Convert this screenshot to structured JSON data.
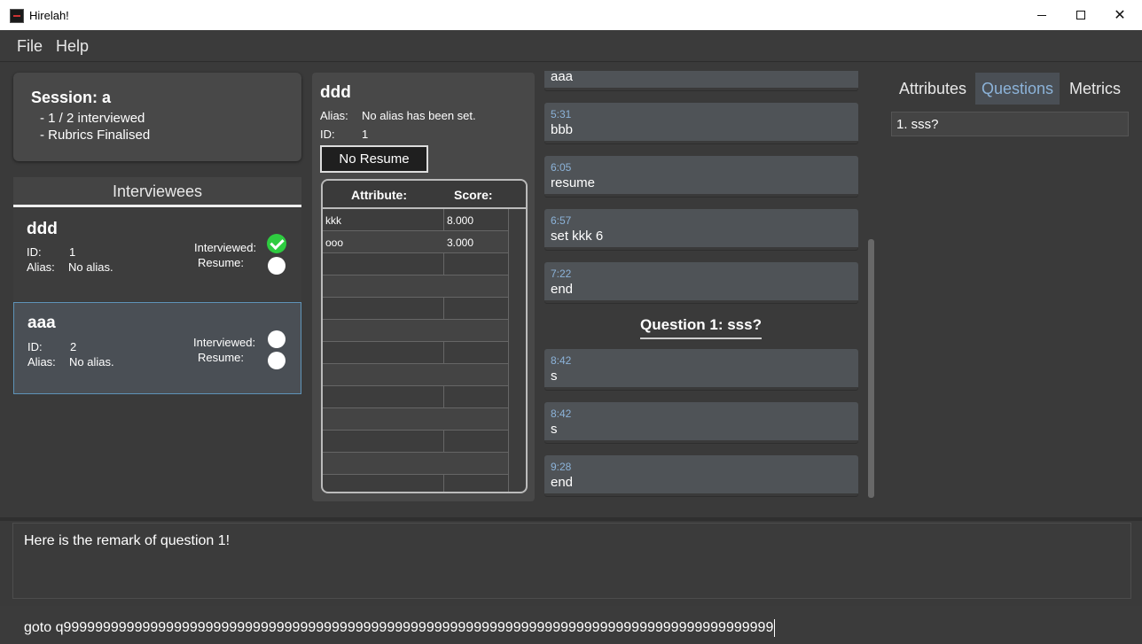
{
  "window": {
    "title": "Hirelah!"
  },
  "menu": {
    "file": "File",
    "help": "Help"
  },
  "session": {
    "title": "Session: a",
    "line1": "- 1 / 2 interviewed",
    "line2": "- Rubrics Finalised"
  },
  "interviewees": {
    "header": "Interviewees",
    "items": [
      {
        "name": "ddd",
        "id_label": "ID:",
        "id": "1",
        "alias_label": "Alias:",
        "alias": "No alias.",
        "interviewed_label": "Interviewed:",
        "resume_label": "Resume:"
      },
      {
        "name": "aaa",
        "id_label": "ID:",
        "id": "2",
        "alias_label": "Alias:",
        "alias": "No alias.",
        "interviewed_label": "Interviewed:",
        "resume_label": "Resume:"
      }
    ]
  },
  "detail": {
    "name": "ddd",
    "alias_label": "Alias:",
    "alias": "No alias has been set.",
    "id_label": "ID:",
    "id": "1",
    "resume_button": "No Resume",
    "table": {
      "col_attribute": "Attribute:",
      "col_score": "Score:",
      "rows": [
        {
          "attribute": "kkk",
          "score": "8.000"
        },
        {
          "attribute": "ooo",
          "score": "3.000"
        }
      ]
    }
  },
  "transcript": {
    "remarks_before": [
      {
        "time": "",
        "text": "aaa"
      },
      {
        "time": "5:31",
        "text": "bbb"
      },
      {
        "time": "6:05",
        "text": "resume"
      },
      {
        "time": "6:57",
        "text": "set kkk 6"
      },
      {
        "time": "7:22",
        "text": "end"
      }
    ],
    "question_title": "Question 1: sss?",
    "remarks_after": [
      {
        "time": "8:42",
        "text": "s"
      },
      {
        "time": "8:42",
        "text": "s"
      },
      {
        "time": "9:28",
        "text": "end"
      }
    ]
  },
  "tabs": {
    "attributes": "Attributes",
    "questions": "Questions",
    "metrics": "Metrics"
  },
  "questions_list": [
    "1. sss?"
  ],
  "result_display": "Here is the remark of question 1!",
  "command_input": "goto q999999999999999999999999999999999999999999999999999999999999999999999999999999999999999999"
}
